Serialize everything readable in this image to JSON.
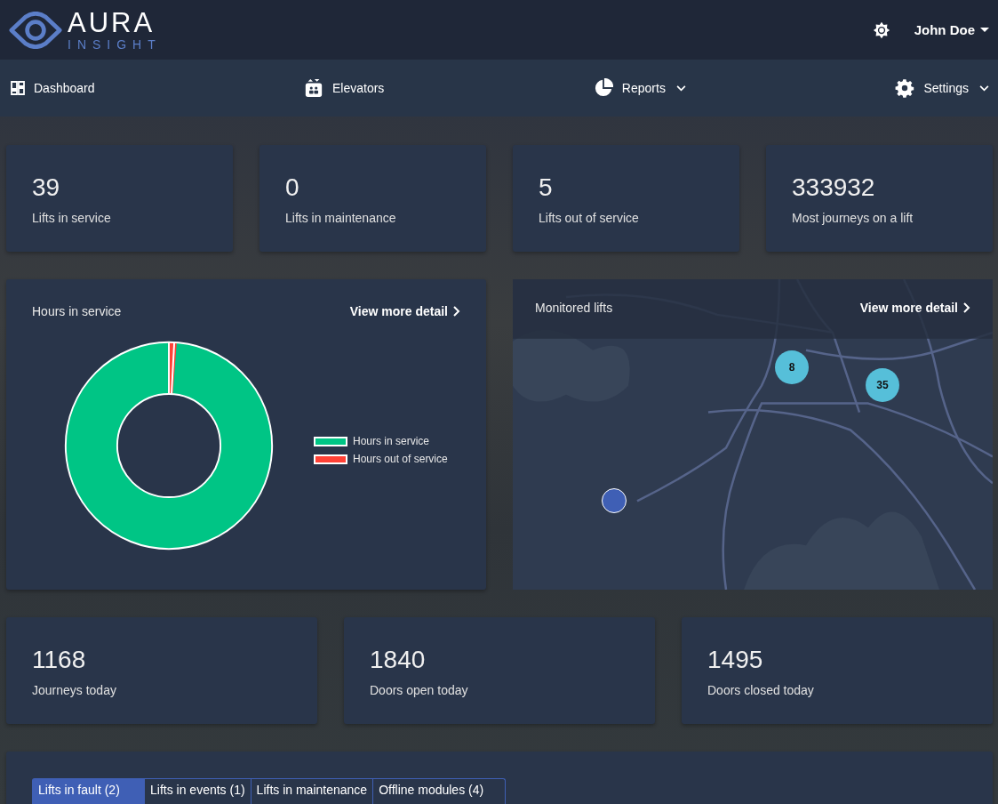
{
  "header": {
    "logo": {
      "word": "AURA",
      "sub": "INSIGHT"
    },
    "user": "John Doe"
  },
  "nav": [
    {
      "label": "Dashboard",
      "dropdown": false
    },
    {
      "label": "Elevators",
      "dropdown": false
    },
    {
      "label": "Reports",
      "dropdown": true
    },
    {
      "label": "Settings",
      "dropdown": true
    }
  ],
  "stats": [
    {
      "value": "39",
      "label": "Lifts in service"
    },
    {
      "value": "0",
      "label": "Lifts in maintenance"
    },
    {
      "value": "5",
      "label": "Lifts out of service"
    },
    {
      "value": "333932",
      "label": "Most journeys on a lift"
    }
  ],
  "hours_card": {
    "title": "Hours in service",
    "link": "View more detail",
    "legend": [
      {
        "label": "Hours in service",
        "color": "#00c585"
      },
      {
        "label": "Hours out of service",
        "color": "#ff4136"
      }
    ]
  },
  "map_card": {
    "title": "Monitored lifts",
    "link": "View more detail",
    "markers": [
      {
        "kind": "cluster",
        "count": "8"
      },
      {
        "kind": "cluster",
        "count": "35"
      },
      {
        "kind": "pin"
      }
    ]
  },
  "daily_stats": [
    {
      "value": "1168",
      "label": "Journeys today"
    },
    {
      "value": "1840",
      "label": "Doors open today"
    },
    {
      "value": "1495",
      "label": "Doors closed today"
    }
  ],
  "tabs": [
    {
      "label": "Lifts in fault (2)",
      "selected": true
    },
    {
      "label": "Lifts in events (1)",
      "selected": false
    },
    {
      "label": "Lifts in maintenance",
      "selected": false
    },
    {
      "label": "Offline modules (4)",
      "selected": false
    }
  ]
}
